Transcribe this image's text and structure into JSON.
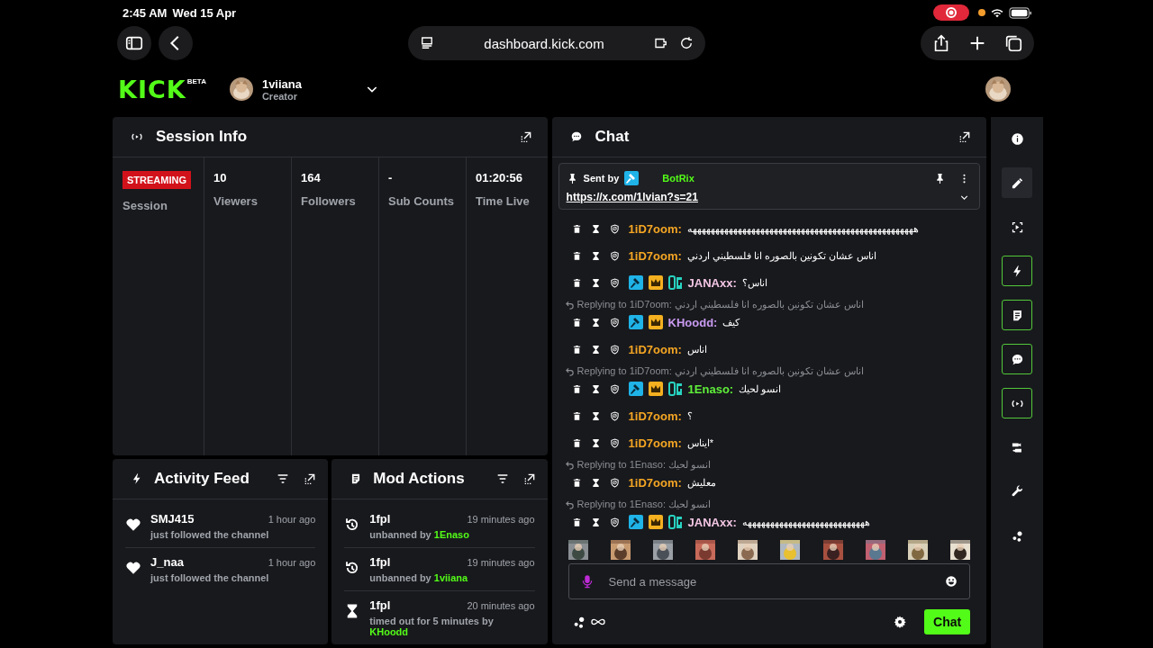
{
  "status_bar": {
    "time": "2:45 AM",
    "date": "Wed 15 Apr"
  },
  "browser": {
    "url": "dashboard.kick.com"
  },
  "header": {
    "logo": "KICK",
    "logo_tag": "BETA",
    "user": "1viiana",
    "role": "Creator"
  },
  "session_info": {
    "title": "Session Info",
    "status": "STREAMING",
    "status_label": "Session",
    "stats": [
      {
        "value": "10",
        "label": "Viewers"
      },
      {
        "value": "164",
        "label": "Followers"
      },
      {
        "value": "-",
        "label": "Sub Counts"
      },
      {
        "value": "01:20:56",
        "label": "Time Live"
      }
    ]
  },
  "activity_feed": {
    "title": "Activity Feed",
    "items": [
      {
        "user": "SMJ415",
        "time": "1 hour ago",
        "text": "just followed the channel"
      },
      {
        "user": "J_naa",
        "time": "1 hour ago",
        "text": "just followed the channel"
      }
    ]
  },
  "mod_actions": {
    "title": "Mod Actions",
    "items": [
      {
        "kind": "unban",
        "user": "1fpl",
        "time": "19 minutes ago",
        "action": "unbanned by",
        "moderator": "1Enaso"
      },
      {
        "kind": "unban",
        "user": "1fpl",
        "time": "19 minutes ago",
        "action": "unbanned by",
        "moderator": "1viiana"
      },
      {
        "kind": "timeout",
        "user": "1fpl",
        "time": "20 minutes ago",
        "action": "timed out for 5 minutes by",
        "moderator": "KHoodd"
      }
    ]
  },
  "chat": {
    "title": "Chat",
    "pinned": {
      "label": "Sent by",
      "sender": "BotRix",
      "link": "https://x.com/1lvian?s=21"
    },
    "messages": [
      {
        "user": "1iD7oom:",
        "color": "#f5a623",
        "text": "ههههههههههههههههههههههههههههههههههههههههههههههههههه"
      },
      {
        "user": "1iD7oom:",
        "color": "#f5a623",
        "text": "اناس عشان تكونين بالصوره انا فلسطيني اردني"
      },
      {
        "user": "JANAxx:",
        "color": "#f3c6e4",
        "badges": [
          {
            "kind": "mod"
          },
          {
            "kind": "vip"
          },
          {
            "kind": "og"
          }
        ],
        "text": "اناس؟"
      },
      {
        "reply": {
          "label": "Replying to 1iD7oom:",
          "text": "اناس عشان تكونين بالصوره انا فلسطيني اردني"
        },
        "user": "KHoodd:",
        "color": "#c89af0",
        "badges": [
          {
            "kind": "mod"
          },
          {
            "kind": "vip"
          }
        ],
        "text": "كيف"
      },
      {
        "user": "1iD7oom:",
        "color": "#f5a623",
        "text": "اناس"
      },
      {
        "reply": {
          "label": "Replying to 1iD7oom:",
          "text": "اناس عشان تكونين بالصوره انا فلسطيني اردني"
        },
        "user": "1Enaso:",
        "color": "#5ff03a",
        "badges": [
          {
            "kind": "mod"
          },
          {
            "kind": "vip"
          },
          {
            "kind": "og"
          }
        ],
        "text": "انسو لحيك"
      },
      {
        "user": "1iD7oom:",
        "color": "#f5a623",
        "text": "؟"
      },
      {
        "user": "1iD7oom:",
        "color": "#f5a623",
        "text": "*ايناس"
      },
      {
        "reply": {
          "label": "Replying to 1Enaso:",
          "text": "انسو لحيك"
        },
        "user": "1iD7oom:",
        "color": "#f5a623",
        "text": "معليش"
      },
      {
        "reply": {
          "label": "Replying to 1Enaso:",
          "text": "انسو لحيك"
        },
        "user": "JANAxx:",
        "color": "#f3c6e4",
        "badges": [
          {
            "kind": "mod"
          },
          {
            "kind": "vip"
          },
          {
            "kind": "og"
          }
        ],
        "text": "هههههههههههههههههههههههههههه"
      }
    ],
    "input": {
      "placeholder": "Send a message"
    },
    "send_button": "Chat"
  },
  "sidebar": [
    {
      "selected": false,
      "active": false
    },
    {
      "selected": true,
      "active": false
    },
    {
      "selected": false,
      "active": false
    },
    {
      "selected": false,
      "active": true
    },
    {
      "selected": false,
      "active": true
    },
    {
      "selected": false,
      "active": true
    },
    {
      "selected": false,
      "active": true
    },
    {
      "selected": false,
      "active": false
    },
    {
      "selected": false,
      "active": false
    },
    {
      "selected": false,
      "active": false
    }
  ]
}
